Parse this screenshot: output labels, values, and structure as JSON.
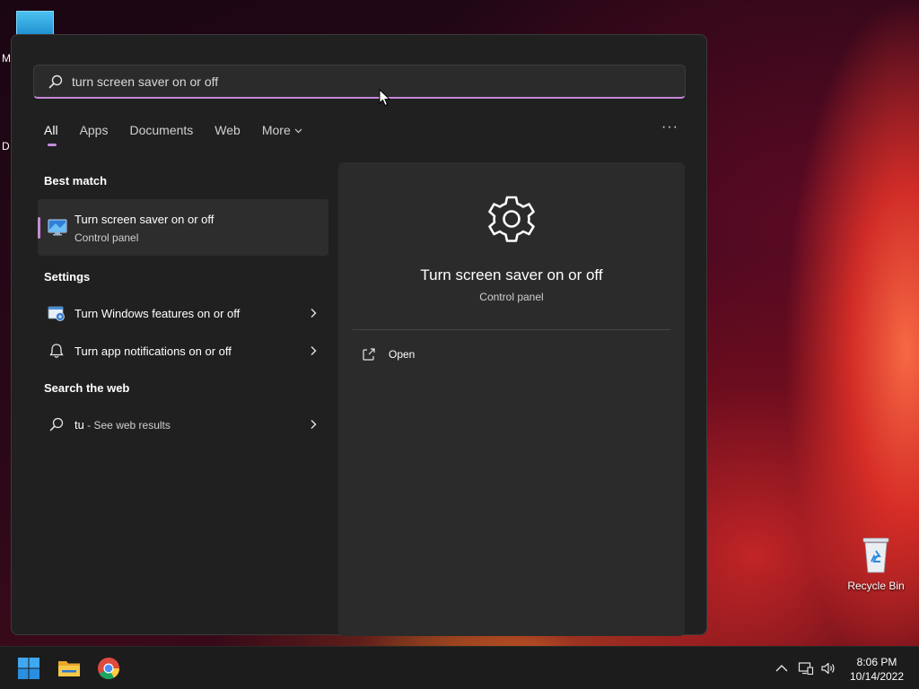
{
  "desktop": {
    "edge_letter_1": "M",
    "edge_letter_2": "D",
    "recycle_bin_label": "Recycle Bin"
  },
  "search": {
    "query": "turn screen saver on or off"
  },
  "tabs": [
    {
      "label": "All",
      "active": true
    },
    {
      "label": "Apps"
    },
    {
      "label": "Documents"
    },
    {
      "label": "Web"
    },
    {
      "label": "More"
    }
  ],
  "more_options_label": "···",
  "best_match": {
    "heading": "Best match",
    "title": "Turn screen saver on or off",
    "subtitle": "Control panel",
    "icon": "screen-saver-icon"
  },
  "settings": {
    "heading": "Settings",
    "items": [
      {
        "label": "Turn Windows features on or off",
        "icon": "windows-features-icon"
      },
      {
        "label": "Turn app notifications on or off",
        "icon": "bell-icon"
      }
    ]
  },
  "web": {
    "heading": "Search the web",
    "query": "tu",
    "suffix": " - See web results"
  },
  "detail": {
    "title": "Turn screen saver on or off",
    "subtitle": "Control panel",
    "icon": "gear-icon",
    "actions": [
      {
        "label": "Open",
        "icon": "open-icon"
      }
    ]
  },
  "taskbar": {
    "apps": [
      "start-icon",
      "file-explorer-icon",
      "chrome-icon"
    ],
    "tray": [
      "chevron-up-icon",
      "network-icon",
      "volume-icon"
    ],
    "time": "8:06 PM",
    "date": "10/14/2022"
  },
  "colors": {
    "accent": "#c58ad8",
    "panel_bg": "#202020",
    "detail_bg": "#2b2b2b"
  }
}
